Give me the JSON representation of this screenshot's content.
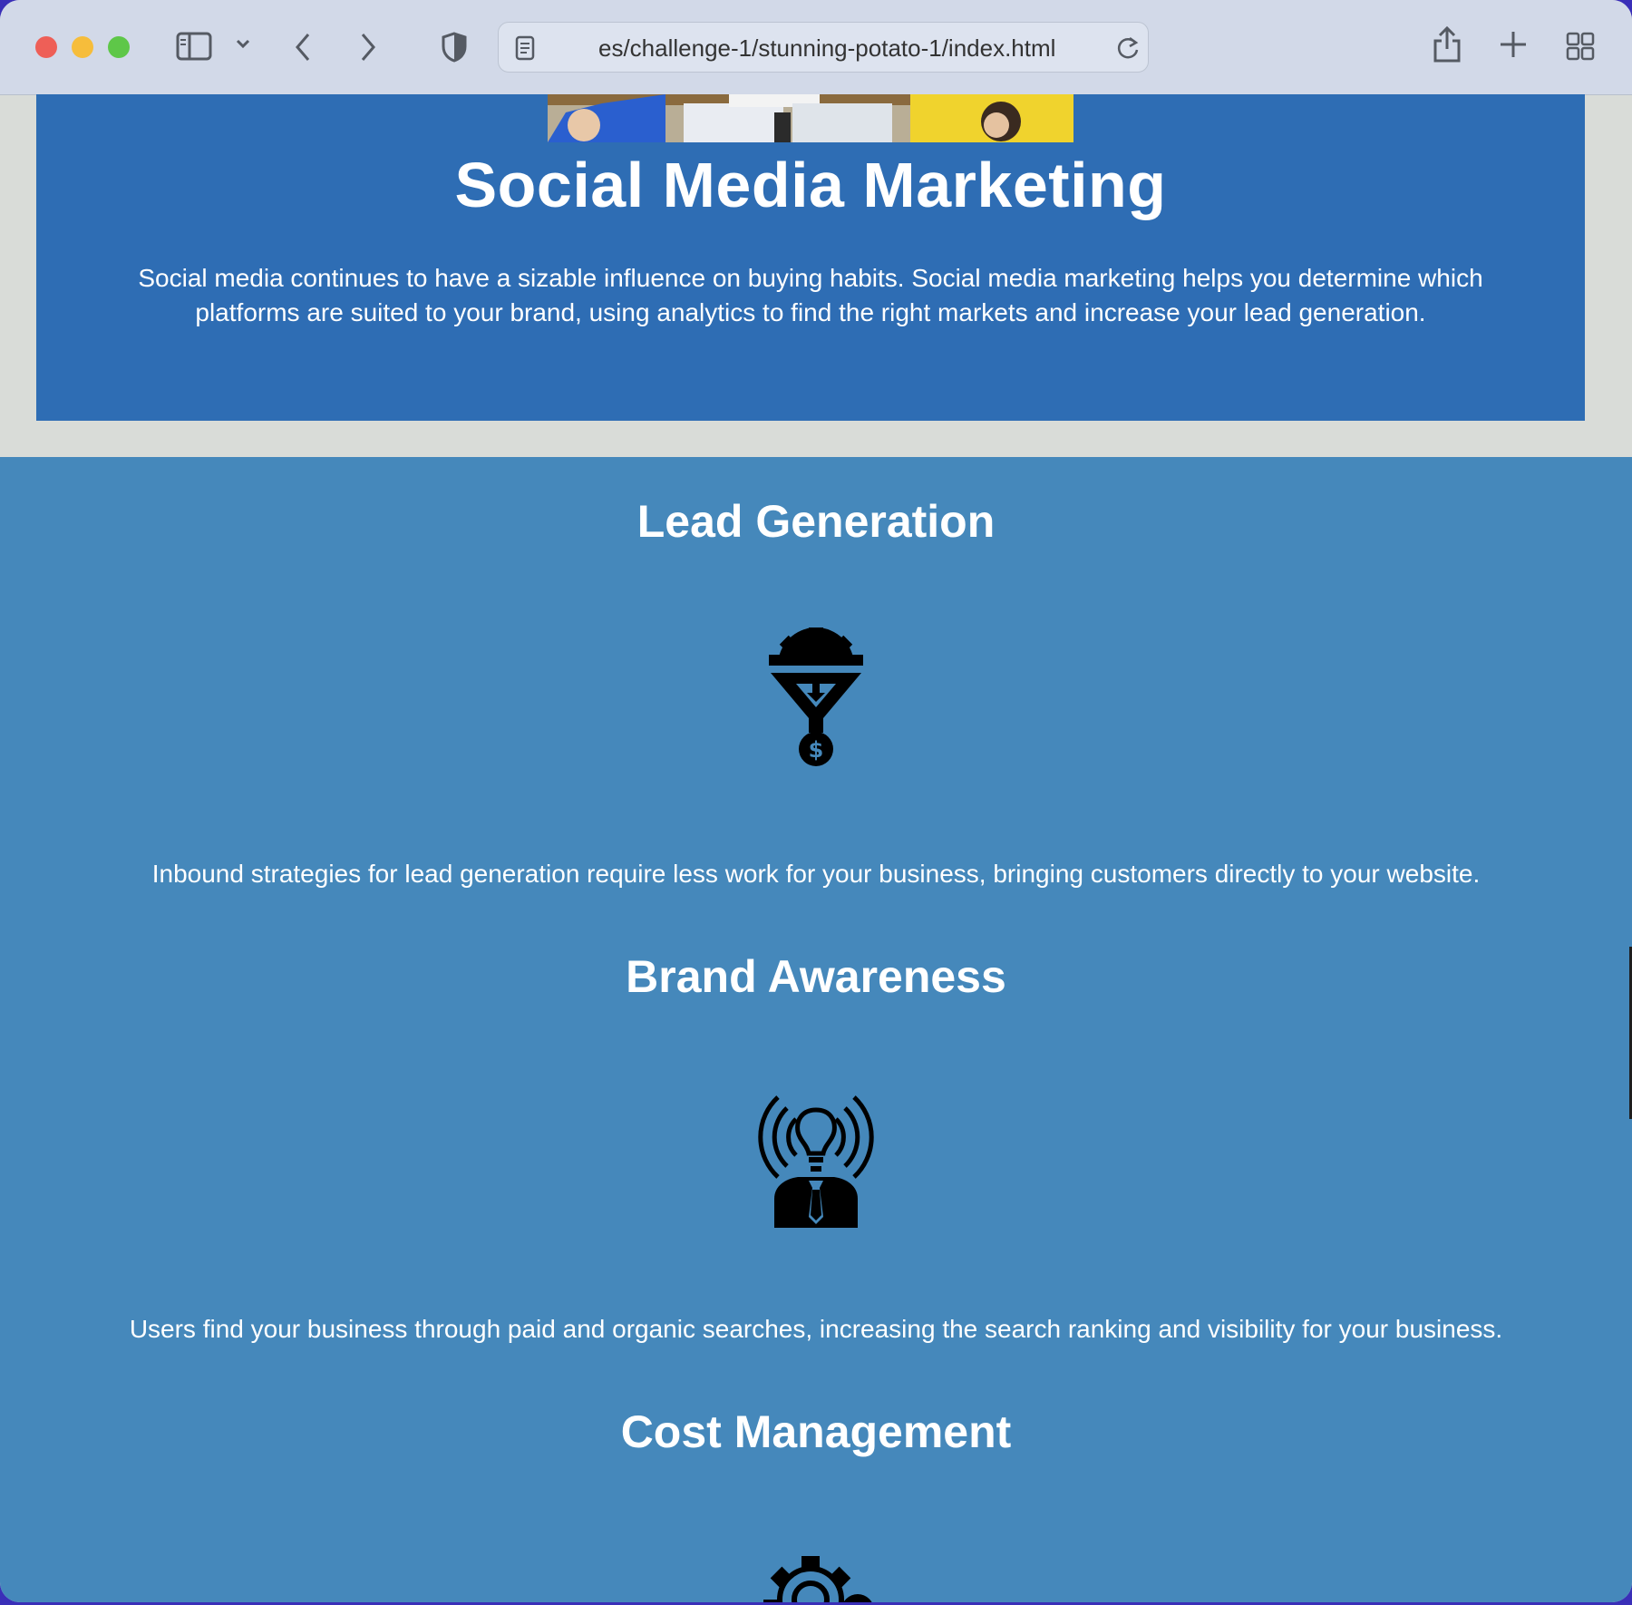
{
  "browser": {
    "url": "es/challenge-1/stunning-potato-1/index.html",
    "buttons": {
      "sidebar": "sidebar-icon",
      "back": "chevron-left-icon",
      "forward": "chevron-right-icon",
      "shield": "shield-icon",
      "reload": "reload-icon",
      "share": "share-icon",
      "new_tab": "plus-icon",
      "tab_overview": "grid-icon"
    }
  },
  "hero": {
    "title": "Social Media Marketing",
    "description": "Social media continues to have a sizable influence on buying habits. Social media marketing helps you determine which platforms are suited to your brand, using analytics to find the right markets and increase your lead generation."
  },
  "features": [
    {
      "title": "Lead Generation",
      "icon": "lead-funnel-icon",
      "text": "Inbound strategies for lead generation require less work for your business, bringing customers directly to your website."
    },
    {
      "title": "Brand Awareness",
      "icon": "brand-idea-broadcast-icon",
      "text": "Users find your business through paid and organic searches, increasing the search ranking and visibility for your business."
    },
    {
      "title": "Cost Management",
      "icon": "cost-gear-icon"
    }
  ],
  "colors": {
    "hero_bg": "#2e6db4",
    "features_bg": "#4588bb",
    "page_bg": "#d9dcd8",
    "text": "#ffffff"
  }
}
